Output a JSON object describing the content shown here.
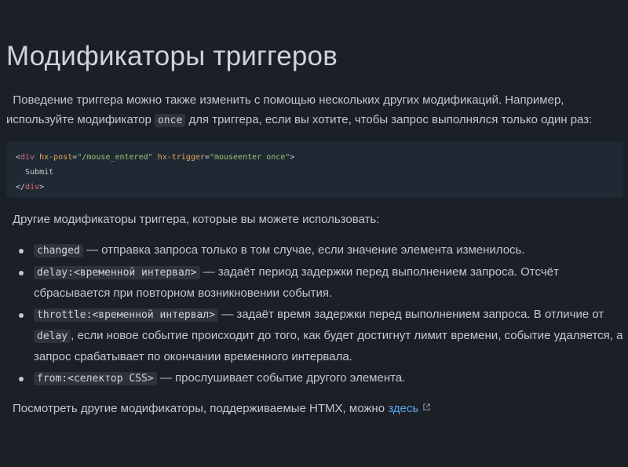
{
  "title": "Модификаторы триггеров",
  "intro": {
    "before": "Поведение триггера можно также изменить с помощью нескольких других модификаций. Например, используйте модификатор",
    "code": "once",
    "after": "для триггера, если вы хотите, чтобы запрос выполнялся только один раз:"
  },
  "code_block": {
    "open_tag": "div",
    "attr1": "hx-post",
    "val1": "\"/mouse_entered\"",
    "attr2": "hx-trigger",
    "val2": "\"mouseenter once\"",
    "body": "Submit",
    "close_tag": "div"
  },
  "lead": "Другие модификаторы триггера, которые вы можете использовать:",
  "modifiers": [
    {
      "code": "changed",
      "text": "— отправка запроса только в том случае, если значение элемента изменилось."
    },
    {
      "code": "delay:<временной интервал>",
      "text": "— задаёт период задержки перед выполнением запроса. Отсчёт сбрасывается при повторном возникновении события."
    },
    {
      "code": "throttle:<временной интервал>",
      "text": "— задаёт время задержки перед выполнением запроса. В отличие от",
      "code2": "delay",
      "text2": ", если новое событие происходит до того, как будет достигнут лимит времени, событие удаляется, а запрос срабатывает по окончании временного интервала."
    },
    {
      "code": "from:<селектор CSS>",
      "text": "— прослушивает событие другого элемента."
    }
  ],
  "footer": {
    "text": "Посмотреть другие модификаторы, поддерживаемые HTMX, можно",
    "link": "здесь",
    "icon": "external-link-icon"
  }
}
